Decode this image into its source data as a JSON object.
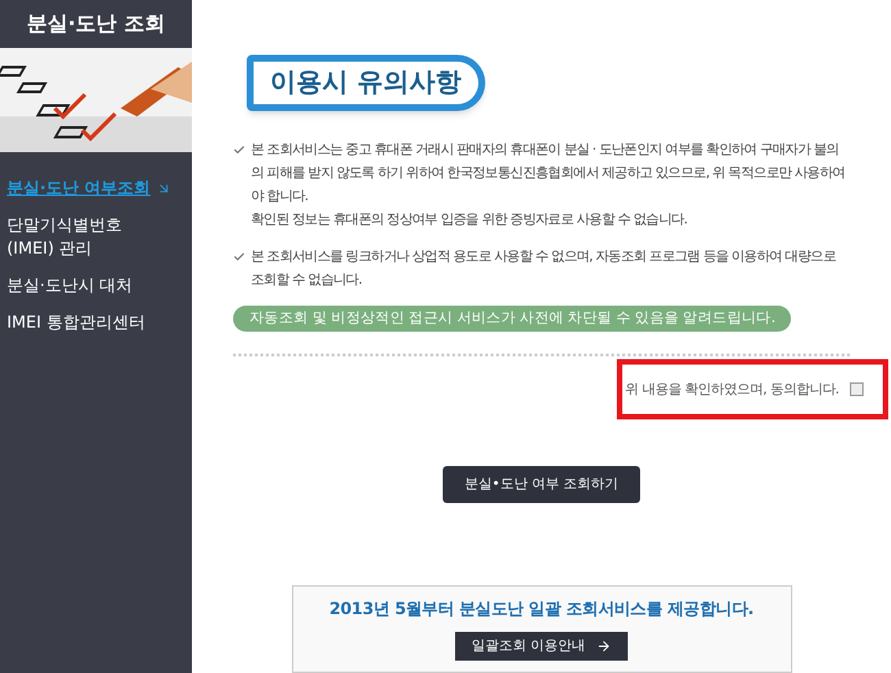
{
  "sidebar": {
    "title": "분실·도난 조회",
    "items": [
      {
        "label": "분실·도난 여부조회",
        "selected": true
      },
      {
        "label": "단말기식별번호\n(IMEI) 관리",
        "selected": false
      },
      {
        "label": "분실·도난시 대처",
        "selected": false
      },
      {
        "label": "IMEI 통합관리센터",
        "selected": false
      }
    ]
  },
  "main": {
    "heading": "이용시 유의사항",
    "notices": [
      {
        "lines": [
          "본 조회서비스는 중고 휴대폰 거래시 판매자의 휴대폰이 분실 · 도난폰인지 여부를 확인하여 구매자가 불의의 피해를 받지 않도록 하기 위하여 한국정보통신진흥협회에서 제공하고 있으므로, 위 목적으로만 사용하여야 합니다.",
          "확인된 정보는 휴대폰의 정상여부 입증을 위한 증빙자료로 사용할 수 없습니다."
        ]
      },
      {
        "lines": [
          "본 조회서비스를 링크하거나 상업적 용도로 사용할 수 없으며, 자동조회 프로그램 등을 이용하여 대량으로 조회할 수 없습니다."
        ]
      }
    ],
    "warning": "자동조회 및 비정상적인 접근시 서비스가 사전에 차단될 수 있음을 알려드립니다.",
    "agree": {
      "label": "위 내용을 확인하였으며, 동의합니다.",
      "checked": false
    },
    "search_button": "분실•도난 여부 조회하기",
    "banner": {
      "text": "2013년 5월부터 분실도난 일괄 조회서비스를 제공합니다.",
      "button": "일괄조회 이용안내"
    }
  }
}
